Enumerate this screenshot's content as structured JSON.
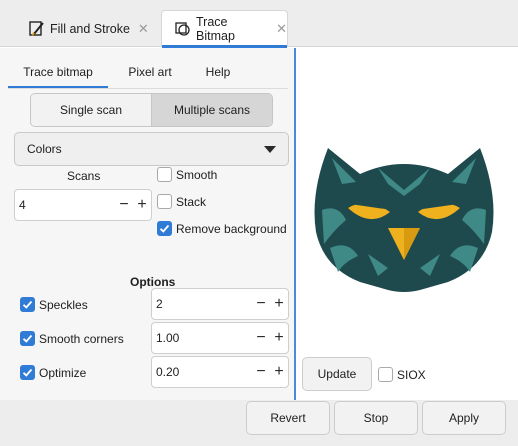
{
  "dock_tabs": [
    {
      "label": "Fill and Stroke",
      "icon": "paintbrush-icon",
      "close": "✕"
    },
    {
      "label": "Trace Bitmap",
      "icon": "trace-bitmap-icon",
      "close": "✕"
    }
  ],
  "sub_tabs": [
    "Trace bitmap",
    "Pixel art",
    "Help"
  ],
  "scan_mode": {
    "options": [
      "Single scan",
      "Multiple scans"
    ],
    "selected": "Multiple scans"
  },
  "mode_select": {
    "value": "Colors"
  },
  "scans": {
    "label": "Scans",
    "value": "4"
  },
  "checks_top": [
    {
      "label": "Smooth",
      "checked": false
    },
    {
      "label": "Stack",
      "checked": false
    },
    {
      "label": "Remove background",
      "checked": true
    }
  ],
  "options_title": "Options",
  "options": [
    {
      "label": "Speckles",
      "value": "2",
      "checked": true
    },
    {
      "label": "Smooth corners",
      "value": "1.00",
      "checked": true
    },
    {
      "label": "Optimize",
      "value": "0.20",
      "checked": true
    }
  ],
  "stepper": {
    "minus": "−",
    "plus": "+"
  },
  "update_label": "Update",
  "siox_label": "SIOX",
  "siox_checked": false,
  "actions": {
    "revert": "Revert",
    "stop": "Stop",
    "apply": "Apply"
  },
  "colors": {
    "accent": "#2f7bd6",
    "owl_teal": "#1f4a4d",
    "owl_feather": "#3f8a86",
    "owl_eye": "#f0b11e"
  }
}
